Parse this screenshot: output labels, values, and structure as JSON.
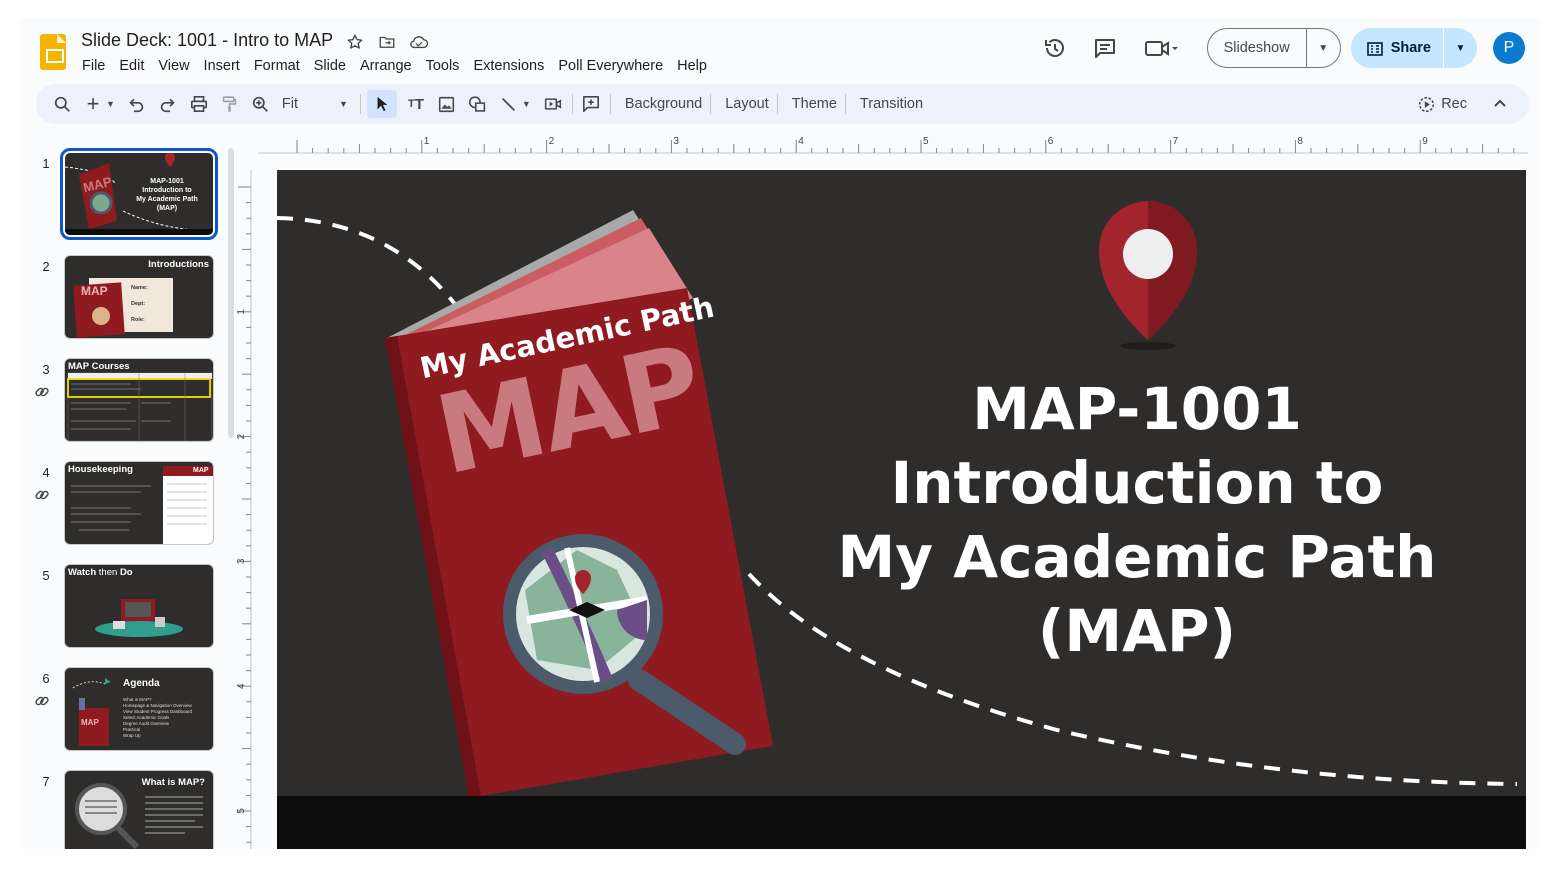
{
  "document": {
    "title": "Slide Deck: 1001 - Intro to MAP"
  },
  "menu": [
    "File",
    "Edit",
    "View",
    "Insert",
    "Format",
    "Slide",
    "Arrange",
    "Tools",
    "Extensions",
    "Poll Everywhere",
    "Help"
  ],
  "header": {
    "slideshow_label": "Slideshow",
    "share_label": "Share",
    "avatar_letter": "P"
  },
  "toolbar": {
    "zoom_label": "Fit",
    "background_label": "Background",
    "layout_label": "Layout",
    "theme_label": "Theme",
    "transition_label": "Transition",
    "rec_label": "Rec"
  },
  "ruler": {
    "horizontal": [
      "1",
      "2",
      "3",
      "4",
      "5",
      "6",
      "7",
      "8",
      "9"
    ],
    "vertical": [
      "1",
      "2",
      "3",
      "4",
      "5"
    ]
  },
  "filmstrip": [
    {
      "number": "1",
      "title": "",
      "linked": false,
      "selected": true,
      "lines": [
        "MAP-1001",
        "Introduction to",
        "My Academic Path",
        "(MAP)"
      ],
      "book_label": "MAP"
    },
    {
      "number": "2",
      "title": "Introductions",
      "linked": false,
      "selected": false,
      "lines": [
        "Name:",
        "Dept:",
        "Role:"
      ],
      "book_label": "MAP"
    },
    {
      "number": "3",
      "title": "MAP Courses",
      "linked": true,
      "selected": false
    },
    {
      "number": "4",
      "title": "Housekeeping",
      "linked": true,
      "selected": false,
      "badge": "MAP"
    },
    {
      "number": "5",
      "title_parts": [
        "Watch",
        " then ",
        "Do"
      ],
      "linked": false,
      "selected": false
    },
    {
      "number": "6",
      "title": "Agenda",
      "linked": true,
      "selected": false,
      "book_label": "MAP",
      "lines": [
        "What is MAP?",
        "Homepage & Navigation Overview",
        "View Student Progress Dashboard",
        "Select Academic Goals",
        "Degree Audit Overview",
        "Practical",
        "Wrap Up"
      ]
    },
    {
      "number": "7",
      "title": "What is MAP?",
      "linked": false,
      "selected": false
    }
  ],
  "slide": {
    "book_title": "My Academic Path",
    "book_big": "MAP",
    "title_lines": [
      "MAP-1001",
      "Introduction to",
      "My Academic Path",
      "(MAP)"
    ]
  },
  "colors": {
    "slide_bg": "#2f2d2b",
    "book_red": "#8f1a1f",
    "pin_red": "#a3242c",
    "accent_blue": "#0b57d0",
    "share_bg": "#c2e7ff",
    "toolbar_bg": "#edf2fa"
  },
  "icons": [
    "star-icon",
    "move-to-folder-icon",
    "cloud-saved-icon",
    "history-icon",
    "comments-icon",
    "meet-camera-icon",
    "search-icon",
    "new-slide-icon",
    "undo-icon",
    "redo-icon",
    "print-icon",
    "paint-format-icon",
    "zoom-icon",
    "select-cursor-icon",
    "text-box-icon",
    "image-icon",
    "shape-icon",
    "line-icon",
    "video-icon",
    "comment-add-icon",
    "rec-icon",
    "chevron-up-icon",
    "link-icon"
  ]
}
